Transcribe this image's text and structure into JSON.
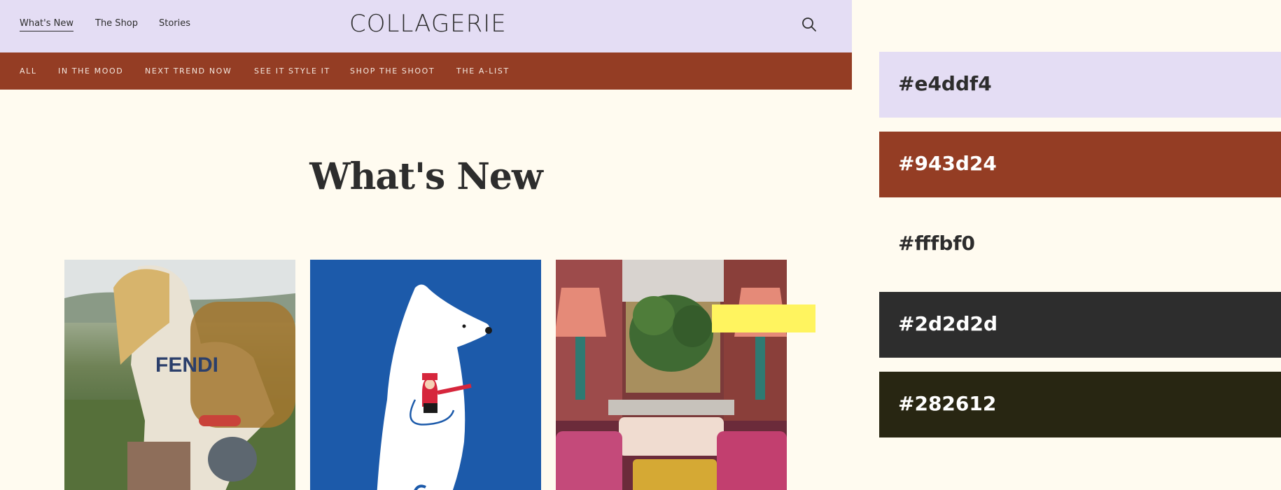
{
  "header": {
    "nav": [
      {
        "label": "What's New",
        "active": true
      },
      {
        "label": "The Shop",
        "active": false
      },
      {
        "label": "Stories",
        "active": false
      }
    ],
    "logo": "COLLAGERIE",
    "search_icon": "search-icon"
  },
  "categories": [
    "ALL",
    "IN THE MOOD",
    "NEXT TREND NOW",
    "SEE IT STYLE IT",
    "SHOP THE SHOOT",
    "THE A-LIST"
  ],
  "main": {
    "title": "What's New",
    "cards": [
      {
        "image": "fashion-photo"
      },
      {
        "image": "bear-illustration"
      },
      {
        "image": "interior-photo"
      }
    ]
  },
  "palette": [
    {
      "hex": "#e4ddf4",
      "label": "#e4ddf4",
      "text_color": "#2d2d2d"
    },
    {
      "hex": "#943d24",
      "label": "#943d24",
      "text_color": "#ffffff"
    },
    {
      "hex": "#fffbf0",
      "label": "#fffbf0",
      "text_color": "#2d2d2d"
    },
    {
      "hex": "#2d2d2d",
      "label": "#2d2d2d",
      "text_color": "#ffffff"
    },
    {
      "hex": "#282612",
      "label": "#282612",
      "text_color": "#ffffff"
    }
  ],
  "colors": {
    "accent_yellow": "#fff45f"
  }
}
